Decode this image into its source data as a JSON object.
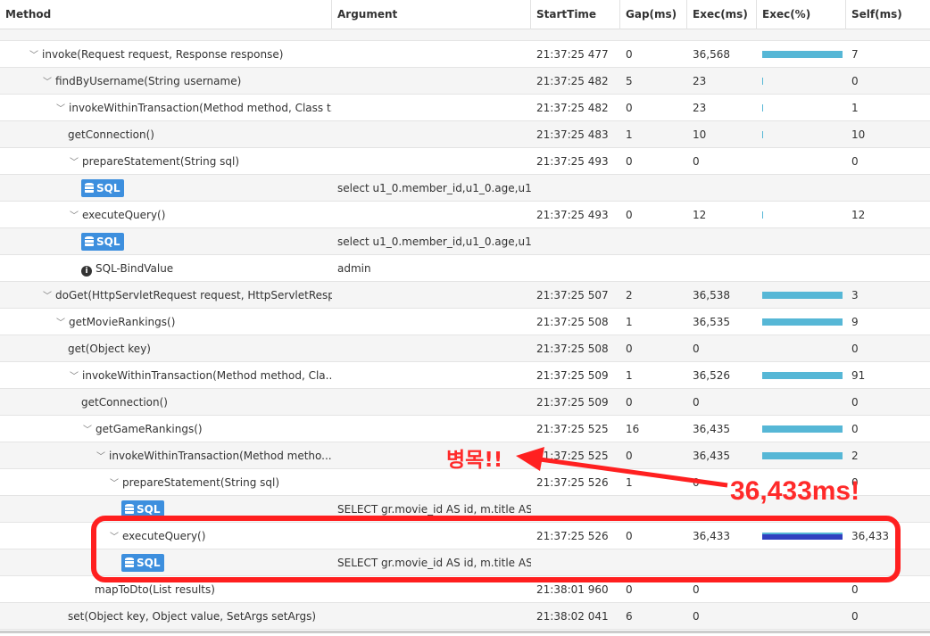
{
  "columns": [
    "Method",
    "Argument",
    "StartTime",
    "Gap(ms)",
    "Exec(ms)",
    "Exec(%)",
    "Self(ms)"
  ],
  "rows": [
    {
      "level": 0,
      "type": "partial",
      "method": "",
      "argument": "",
      "start": "",
      "gap": "",
      "exec": "",
      "pct": null,
      "self": ""
    },
    {
      "level": 0,
      "chevron": true,
      "method": "invoke(Request request, Response response)",
      "argument": "",
      "start": "21:37:25 477",
      "gap": "0",
      "exec": "36,568",
      "pct": 99.9,
      "self": "7"
    },
    {
      "level": 1,
      "chevron": true,
      "method": "findByUsername(String username)",
      "argument": "",
      "start": "21:37:25 482",
      "gap": "5",
      "exec": "23",
      "pct": 0.5,
      "self": "0"
    },
    {
      "level": 2,
      "chevron": true,
      "method": "invokeWithinTransaction(Method method, Class t...",
      "argument": "",
      "start": "21:37:25 482",
      "gap": "0",
      "exec": "23",
      "pct": 0.5,
      "self": "1"
    },
    {
      "level": 3,
      "method": "getConnection()",
      "argument": "",
      "start": "21:37:25 483",
      "gap": "1",
      "exec": "10",
      "pct": 0.3,
      "self": "10"
    },
    {
      "level": 3,
      "chevron": true,
      "method": "prepareStatement(String sql)",
      "argument": "",
      "start": "21:37:25 493",
      "gap": "0",
      "exec": "0",
      "pct": 0,
      "self": "0"
    },
    {
      "level": 4,
      "type": "sql",
      "method": "SQL",
      "argument": "select u1_0.member_id,u1_0.age,u1...",
      "start": "",
      "gap": "",
      "exec": "",
      "pct": null,
      "self": ""
    },
    {
      "level": 3,
      "chevron": true,
      "method": "executeQuery()",
      "argument": "",
      "start": "21:37:25 493",
      "gap": "0",
      "exec": "12",
      "pct": 0.3,
      "self": "12"
    },
    {
      "level": 4,
      "type": "sql",
      "method": "SQL",
      "argument": "select u1_0.member_id,u1_0.age,u1...",
      "start": "",
      "gap": "",
      "exec": "",
      "pct": null,
      "self": ""
    },
    {
      "level": 4,
      "type": "info",
      "method": "SQL-BindValue",
      "argument": "admin",
      "start": "",
      "gap": "",
      "exec": "",
      "pct": null,
      "self": ""
    },
    {
      "level": 1,
      "chevron": true,
      "method": "doGet(HttpServletRequest request, HttpServletResp...",
      "argument": "",
      "start": "21:37:25 507",
      "gap": "2",
      "exec": "36,538",
      "pct": 99.9,
      "self": "3"
    },
    {
      "level": 2,
      "chevron": true,
      "method": "getMovieRankings()",
      "argument": "",
      "start": "21:37:25 508",
      "gap": "1",
      "exec": "36,535",
      "pct": 99.9,
      "self": "9"
    },
    {
      "level": 3,
      "method": "get(Object key)",
      "argument": "",
      "start": "21:37:25 508",
      "gap": "0",
      "exec": "0",
      "pct": 0,
      "self": "0"
    },
    {
      "level": 3,
      "chevron": true,
      "method": "invokeWithinTransaction(Method method, Cla...",
      "argument": "",
      "start": "21:37:25 509",
      "gap": "1",
      "exec": "36,526",
      "pct": 99.9,
      "self": "91"
    },
    {
      "level": 4,
      "method": "getConnection()",
      "argument": "",
      "start": "21:37:25 509",
      "gap": "0",
      "exec": "0",
      "pct": 0,
      "self": "0"
    },
    {
      "level": 4,
      "chevron": true,
      "method": "getGameRankings()",
      "argument": "",
      "start": "21:37:25 525",
      "gap": "16",
      "exec": "36,435",
      "pct": 99.6,
      "self": "0"
    },
    {
      "level": 5,
      "chevron": true,
      "method": "invokeWithinTransaction(Method metho...",
      "argument": "",
      "start": "21:37:25 525",
      "gap": "0",
      "exec": "36,435",
      "pct": 99.6,
      "self": "2"
    },
    {
      "level": 6,
      "chevron": true,
      "method": "prepareStatement(String sql)",
      "argument": "",
      "start": "21:37:25 526",
      "gap": "1",
      "exec": "0",
      "pct": 0,
      "self": "0"
    },
    {
      "level": 7,
      "type": "sql",
      "method": "SQL",
      "argument": "SELECT gr.movie_id AS id, m.title AS ...",
      "start": "",
      "gap": "",
      "exec": "",
      "pct": null,
      "self": ""
    },
    {
      "level": 6,
      "chevron": true,
      "hot": true,
      "method": "executeQuery()",
      "argument": "",
      "start": "21:37:25 526",
      "gap": "0",
      "exec": "36,433",
      "pct": 99.6,
      "self": "36,433"
    },
    {
      "level": 7,
      "type": "sql",
      "method": "SQL",
      "argument": "SELECT gr.movie_id AS id, m.title AS ...",
      "start": "",
      "gap": "",
      "exec": "",
      "pct": null,
      "self": ""
    },
    {
      "level": 5,
      "method": "mapToDto(List results)",
      "argument": "",
      "start": "21:38:01 960",
      "gap": "0",
      "exec": "0",
      "pct": 0,
      "self": "0"
    },
    {
      "level": 3,
      "method": "set(Object key, Object value, SetArgs setArgs)",
      "argument": "",
      "start": "21:38:02 041",
      "gap": "6",
      "exec": "0",
      "pct": 0,
      "self": "0"
    }
  ],
  "annotations": {
    "bottleneck": "병목!!",
    "duration": "36,433ms!",
    "color": "#ff2020"
  },
  "colors": {
    "bar": "#56b7d6",
    "bar_hot": "#3040c0",
    "sql_badge": "#3d8fde"
  }
}
